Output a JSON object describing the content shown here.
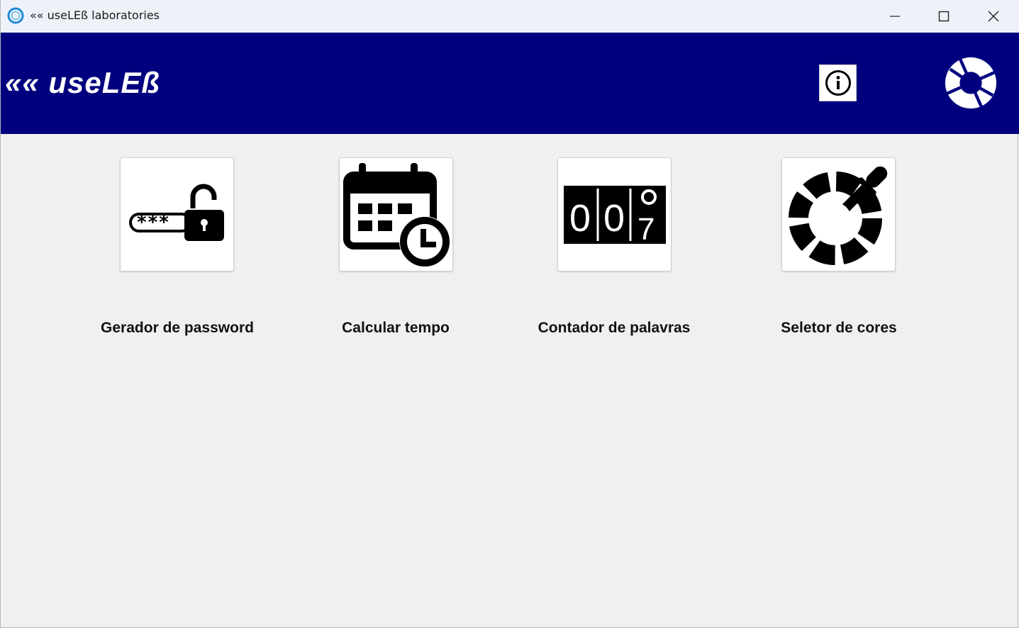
{
  "window": {
    "title": "«« useLEß laboratories",
    "minimize_icon": "minimize-icon",
    "maximize_icon": "maximize-icon",
    "close_icon": "close-icon"
  },
  "header": {
    "brand": "«« useLEß",
    "background_color": "#00007f",
    "info_icon": "info-icon",
    "logo_icon": "aperture-logo-icon"
  },
  "tools": [
    {
      "label": "Gerador de password",
      "icon": "password-lock-icon"
    },
    {
      "label": "Calcular tempo",
      "icon": "calendar-clock-icon"
    },
    {
      "label": "Contador de palavras",
      "icon": "counter-icon",
      "counter_digits": [
        "0",
        "0",
        "7"
      ]
    },
    {
      "label": "Seletor de cores",
      "icon": "color-picker-icon"
    }
  ]
}
